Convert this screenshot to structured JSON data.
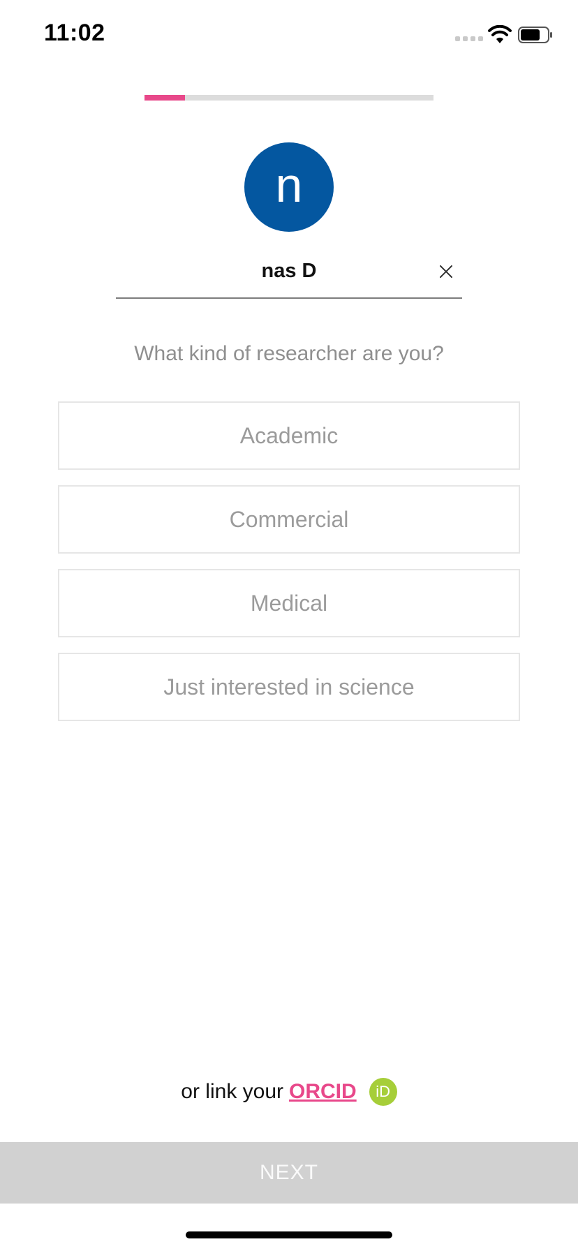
{
  "status_bar": {
    "time": "11:02",
    "icons": [
      "cellular-signal-icon",
      "wifi-icon",
      "battery-icon"
    ]
  },
  "progress": {
    "value": 0.14,
    "accent": "#e8488a"
  },
  "avatar": {
    "initial": "n",
    "color": "#0457a0"
  },
  "name_field": {
    "value": "nas D",
    "clear_icon": "close-icon"
  },
  "question": "What kind of researcher are you?",
  "options": [
    {
      "label": "Academic"
    },
    {
      "label": "Commercial"
    },
    {
      "label": "Medical"
    },
    {
      "label": "Just interested in science"
    }
  ],
  "orcid": {
    "prefix": "or link your",
    "link_label": "ORCID",
    "icon_label": "iD",
    "icon_color": "#a6ce39"
  },
  "next_button": {
    "label": "NEXT"
  }
}
